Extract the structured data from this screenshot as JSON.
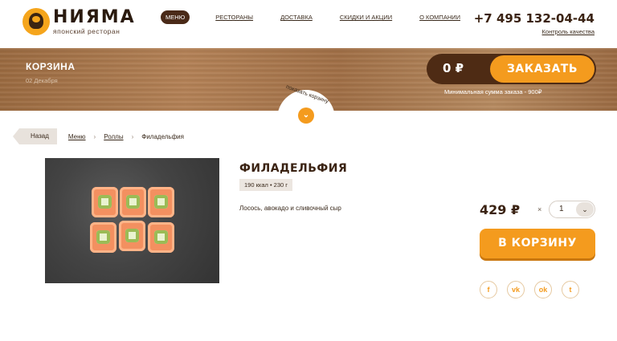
{
  "header": {
    "logo_name": "НИЯМА",
    "logo_sub": "японский ресторан",
    "nav": [
      {
        "label": "МЕНЮ",
        "active": true
      },
      {
        "label": "РЕСТОРАНЫ"
      },
      {
        "label": "ДОСТАВКА"
      },
      {
        "label": "СКИДКИ И АКЦИИ"
      },
      {
        "label": "О КОМПАНИИ"
      }
    ],
    "phone": "+7 495 132-04-44",
    "quality_link": "Контроль качества"
  },
  "banner": {
    "cart_title": "КОРЗИНА",
    "cart_date": "02 Декабря",
    "cart_sum": "0 ₽",
    "order_label": "ЗАКАЗАТЬ",
    "min_order": "Минимальная сумма заказа - 900₽",
    "show_cart_label": "показать корзину"
  },
  "breadcrumb": {
    "back": "Назад",
    "items": [
      "Меню",
      "Роллы",
      "Филадельфия"
    ]
  },
  "product": {
    "title": "ФИЛАДЕЛЬФИЯ",
    "meta": "190 ккал • 230 г",
    "description": "Лосось, авокадо и сливочный сыр",
    "price": "429 ₽",
    "times": "×",
    "quantity": "1",
    "add_to_cart": "В КОРЗИНУ"
  },
  "socials": [
    {
      "icon": "facebook-icon",
      "glyph": "f"
    },
    {
      "icon": "vk-icon",
      "glyph": "vk"
    },
    {
      "icon": "odnoklassniki-icon",
      "glyph": "ok"
    },
    {
      "icon": "twitter-icon",
      "glyph": "t"
    }
  ],
  "colors": {
    "accent": "#f49b1e",
    "dark_brown": "#4e2b14",
    "wood": "#a9774c"
  }
}
